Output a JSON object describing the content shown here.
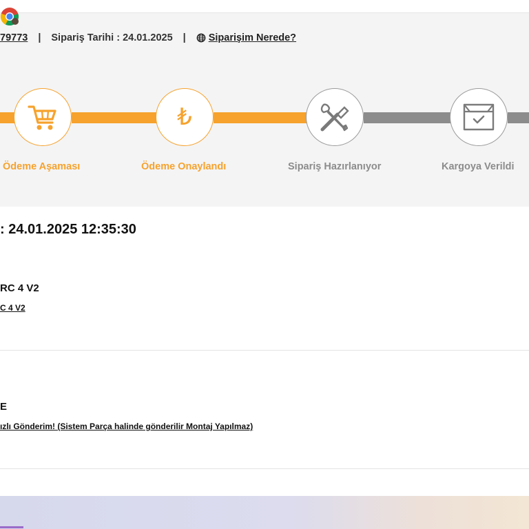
{
  "order": {
    "number_fragment": "79773",
    "date_label": "Sipariş Tarihi : 24.01.2025",
    "track_link": "Siparişim Nerede?",
    "separator": "|"
  },
  "steps": [
    {
      "label": "Ödeme Aşaması",
      "icon": "cart-icon",
      "state": "done"
    },
    {
      "label": "Ödeme Onaylandı",
      "icon": "lira-icon",
      "state": "done"
    },
    {
      "label": "Sipariş Hazırlanıyor",
      "icon": "tools-icon",
      "state": "pending"
    },
    {
      "label": "Kargoya Verildi",
      "icon": "box-icon",
      "state": "pending"
    }
  ],
  "lira_symbol": "₺",
  "delivery_date": ": 24.01.2025 12:35:30",
  "items": [
    {
      "title": "RC 4 V2",
      "link": "C 4 V2"
    },
    {
      "title": "E",
      "link": "ızlı Gönderim! (Sistem Parça halinde gönderilir Montaj Yapılmaz)"
    }
  ],
  "taskbar": {
    "app_icon": "chrome-icon"
  },
  "colors": {
    "accent": "#f6a22d",
    "inactive": "#8c8c8c",
    "panel": "#f4f4f4"
  }
}
